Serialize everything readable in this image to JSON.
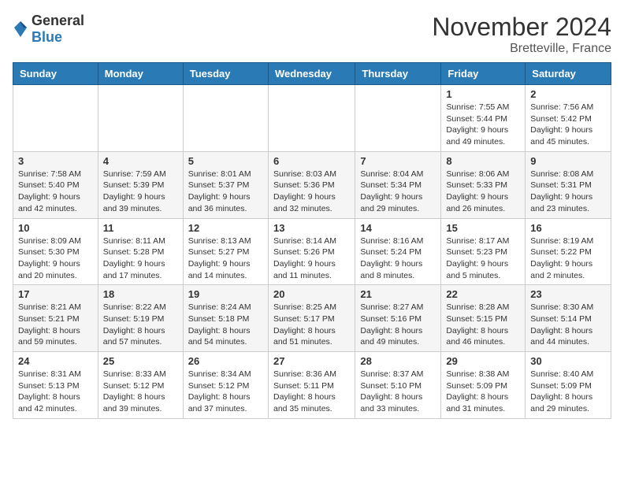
{
  "header": {
    "logo_general": "General",
    "logo_blue": "Blue",
    "month_title": "November 2024",
    "location": "Bretteville, France"
  },
  "calendar": {
    "days_of_week": [
      "Sunday",
      "Monday",
      "Tuesday",
      "Wednesday",
      "Thursday",
      "Friday",
      "Saturday"
    ],
    "weeks": [
      [
        {
          "day": "",
          "info": ""
        },
        {
          "day": "",
          "info": ""
        },
        {
          "day": "",
          "info": ""
        },
        {
          "day": "",
          "info": ""
        },
        {
          "day": "",
          "info": ""
        },
        {
          "day": "1",
          "info": "Sunrise: 7:55 AM\nSunset: 5:44 PM\nDaylight: 9 hours and 49 minutes."
        },
        {
          "day": "2",
          "info": "Sunrise: 7:56 AM\nSunset: 5:42 PM\nDaylight: 9 hours and 45 minutes."
        }
      ],
      [
        {
          "day": "3",
          "info": "Sunrise: 7:58 AM\nSunset: 5:40 PM\nDaylight: 9 hours and 42 minutes."
        },
        {
          "day": "4",
          "info": "Sunrise: 7:59 AM\nSunset: 5:39 PM\nDaylight: 9 hours and 39 minutes."
        },
        {
          "day": "5",
          "info": "Sunrise: 8:01 AM\nSunset: 5:37 PM\nDaylight: 9 hours and 36 minutes."
        },
        {
          "day": "6",
          "info": "Sunrise: 8:03 AM\nSunset: 5:36 PM\nDaylight: 9 hours and 32 minutes."
        },
        {
          "day": "7",
          "info": "Sunrise: 8:04 AM\nSunset: 5:34 PM\nDaylight: 9 hours and 29 minutes."
        },
        {
          "day": "8",
          "info": "Sunrise: 8:06 AM\nSunset: 5:33 PM\nDaylight: 9 hours and 26 minutes."
        },
        {
          "day": "9",
          "info": "Sunrise: 8:08 AM\nSunset: 5:31 PM\nDaylight: 9 hours and 23 minutes."
        }
      ],
      [
        {
          "day": "10",
          "info": "Sunrise: 8:09 AM\nSunset: 5:30 PM\nDaylight: 9 hours and 20 minutes."
        },
        {
          "day": "11",
          "info": "Sunrise: 8:11 AM\nSunset: 5:28 PM\nDaylight: 9 hours and 17 minutes."
        },
        {
          "day": "12",
          "info": "Sunrise: 8:13 AM\nSunset: 5:27 PM\nDaylight: 9 hours and 14 minutes."
        },
        {
          "day": "13",
          "info": "Sunrise: 8:14 AM\nSunset: 5:26 PM\nDaylight: 9 hours and 11 minutes."
        },
        {
          "day": "14",
          "info": "Sunrise: 8:16 AM\nSunset: 5:24 PM\nDaylight: 9 hours and 8 minutes."
        },
        {
          "day": "15",
          "info": "Sunrise: 8:17 AM\nSunset: 5:23 PM\nDaylight: 9 hours and 5 minutes."
        },
        {
          "day": "16",
          "info": "Sunrise: 8:19 AM\nSunset: 5:22 PM\nDaylight: 9 hours and 2 minutes."
        }
      ],
      [
        {
          "day": "17",
          "info": "Sunrise: 8:21 AM\nSunset: 5:21 PM\nDaylight: 8 hours and 59 minutes."
        },
        {
          "day": "18",
          "info": "Sunrise: 8:22 AM\nSunset: 5:19 PM\nDaylight: 8 hours and 57 minutes."
        },
        {
          "day": "19",
          "info": "Sunrise: 8:24 AM\nSunset: 5:18 PM\nDaylight: 8 hours and 54 minutes."
        },
        {
          "day": "20",
          "info": "Sunrise: 8:25 AM\nSunset: 5:17 PM\nDaylight: 8 hours and 51 minutes."
        },
        {
          "day": "21",
          "info": "Sunrise: 8:27 AM\nSunset: 5:16 PM\nDaylight: 8 hours and 49 minutes."
        },
        {
          "day": "22",
          "info": "Sunrise: 8:28 AM\nSunset: 5:15 PM\nDaylight: 8 hours and 46 minutes."
        },
        {
          "day": "23",
          "info": "Sunrise: 8:30 AM\nSunset: 5:14 PM\nDaylight: 8 hours and 44 minutes."
        }
      ],
      [
        {
          "day": "24",
          "info": "Sunrise: 8:31 AM\nSunset: 5:13 PM\nDaylight: 8 hours and 42 minutes."
        },
        {
          "day": "25",
          "info": "Sunrise: 8:33 AM\nSunset: 5:12 PM\nDaylight: 8 hours and 39 minutes."
        },
        {
          "day": "26",
          "info": "Sunrise: 8:34 AM\nSunset: 5:12 PM\nDaylight: 8 hours and 37 minutes."
        },
        {
          "day": "27",
          "info": "Sunrise: 8:36 AM\nSunset: 5:11 PM\nDaylight: 8 hours and 35 minutes."
        },
        {
          "day": "28",
          "info": "Sunrise: 8:37 AM\nSunset: 5:10 PM\nDaylight: 8 hours and 33 minutes."
        },
        {
          "day": "29",
          "info": "Sunrise: 8:38 AM\nSunset: 5:09 PM\nDaylight: 8 hours and 31 minutes."
        },
        {
          "day": "30",
          "info": "Sunrise: 8:40 AM\nSunset: 5:09 PM\nDaylight: 8 hours and 29 minutes."
        }
      ]
    ]
  }
}
